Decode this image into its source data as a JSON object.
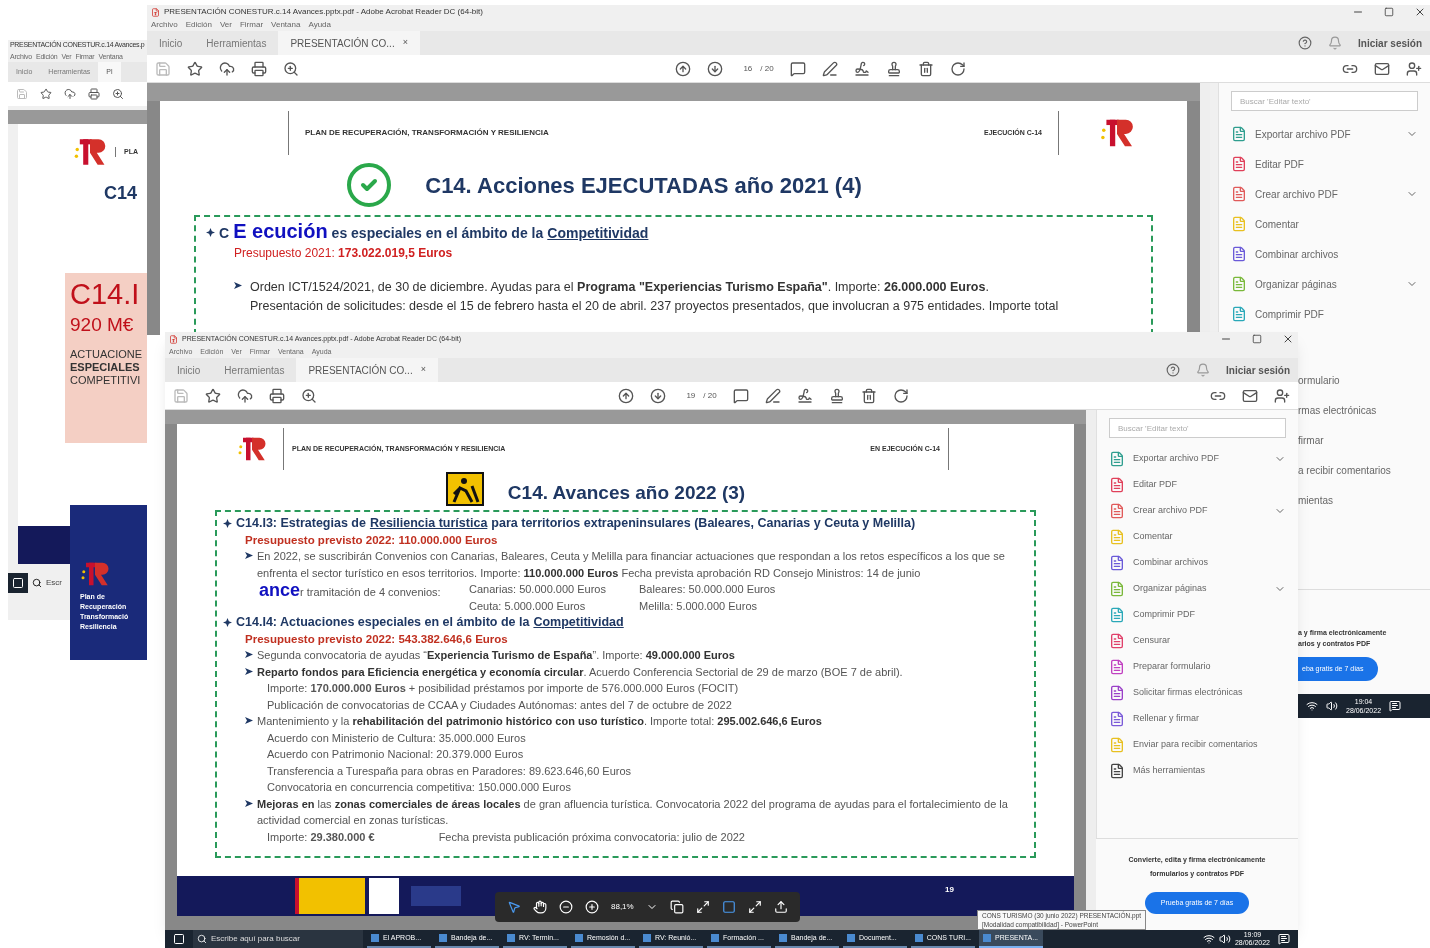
{
  "back_window": {
    "title": "PRESENTACIÓN CONESTUR.c.14 Avances.p",
    "menu": [
      "Archivo",
      "Edición",
      "Ver",
      "Firmar",
      "Ventana"
    ],
    "tabs": [
      {
        "label": "Inicio",
        "selected": false
      },
      {
        "label": "Herramientas",
        "selected": false
      },
      {
        "label": "Pl",
        "selected": true
      }
    ],
    "slide": {
      "header": "PLA",
      "title": "C14",
      "card_code": "C14.I",
      "card_amount": "920 M€",
      "card_lines": [
        "ACTUACIONE",
        "**ESPECIALES**",
        "COMPETITIVI"
      ]
    },
    "taskbar_search": "Escr"
  },
  "blue_card": {
    "lines": [
      "Plan de",
      "Recuperación",
      "Transformació",
      "Resiliencia"
    ]
  },
  "top_window": {
    "title": "PRESENTACIÓN CONESTUR.c.14 Avances.pptx.pdf - Adobe Acrobat Reader DC (64-bit)",
    "menu": [
      "Archivo",
      "Edición",
      "Ver",
      "Firmar",
      "Ventana",
      "Ayuda"
    ],
    "tabs": [
      {
        "label": "Inicio",
        "selected": false
      },
      {
        "label": "Herramientas",
        "selected": false
      },
      {
        "label": "PRESENTACIÓN CO...",
        "selected": true,
        "close": "×"
      }
    ],
    "sign_in": "Iniciar sesión",
    "page": "16",
    "page_total": "/ 20",
    "slide": {
      "header": "PLAN DE RECUPERACIÓN, TRANSFORMACIÓN Y RESILIENCIA",
      "tag": "EJECUCIÓN C-14",
      "title": "C14. Acciones EJECUTADAS año 2021 (4)",
      "heading_start": "C",
      "overlay": "E ecución",
      "heading_rest": "es especiales en el ámbito de la",
      "heading_link": "Competitividad",
      "budget": "Presupuesto 2021: **173.022.019,5 Euros**",
      "bullet": "Orden ICT/1524/2021, de 30 de diciembre. Ayudas para el **Programa \"Experiencias Turismo España\"**.  Importe: **26.000.000 Euros**.",
      "bullet_cont": "Presentación de solicitudes: desde el 15 de febrero hasta el 20 de abril. 237 proyectos presentados, que involucran a 975 entidades. Importe total"
    },
    "search_placeholder": "Buscar 'Editar texto'",
    "tools": [
      {
        "label": "Exportar archivo PDF",
        "color": "#2f9e8f",
        "expandable": true
      },
      {
        "label": "Editar PDF",
        "color": "#e0405a",
        "expandable": false
      },
      {
        "label": "Crear archivo PDF",
        "color": "#e05a5a",
        "expandable": true
      },
      {
        "label": "Comentar",
        "color": "#e8c020",
        "expandable": false
      },
      {
        "label": "Combinar archivos",
        "color": "#6a5ad8",
        "expandable": false
      },
      {
        "label": "Organizar páginas",
        "color": "#7ab83a",
        "expandable": true
      },
      {
        "label": "Comprimir PDF",
        "color": "#2aa8b8",
        "expandable": false
      }
    ],
    "covered_tools": [
      "ormulario",
      "rmas electrónicas",
      "firmar",
      "a recibir comentarios",
      "mientas"
    ],
    "promo": [
      "a y firma electrónicamente",
      "arios y contratos PDF"
    ],
    "trial_button": "eba gratis de 7 días",
    "clock": {
      "time": "19:04",
      "date": "28/06/2022"
    }
  },
  "front_window": {
    "title": "PRESENTACIÓN CONESTUR.c.14 Avances.pptx.pdf - Adobe Acrobat Reader DC (64-bit)",
    "menu": [
      "Archivo",
      "Edición",
      "Ver",
      "Firmar",
      "Ventana",
      "Ayuda"
    ],
    "tabs": [
      {
        "label": "Inicio",
        "selected": false
      },
      {
        "label": "Herramientas",
        "selected": false
      },
      {
        "label": "PRESENTACIÓN CO...",
        "selected": true,
        "close": "×"
      }
    ],
    "sign_in": "Iniciar sesión",
    "page": "19",
    "page_total": "/ 20",
    "slide": {
      "header": "PLAN DE RECUPERACIÓN, TRANSFORMACIÓN Y RESILIENCIA",
      "tag": "EN EJECUCIÓN C-14",
      "title": "C14. Avances año 2022 (3)",
      "sections": [
        {
          "heading": "C14.I3: Estrategias de",
          "heading_link": "Resiliencia turística",
          "heading_rest": "para territorios extrapeninsulares (Baleares, Canarias y Ceuta y Melilla)",
          "budget": "Presupuesto previsto 2022: 110.000.000 Euros",
          "bullets": [
            {
              "text": "En 2022, se suscribirán Convenios con Canarias, Baleares, Ceuta y Melilla para financiar actuaciones que respondan a los retos específicos a los que se enfrenta el sector turístico en esos territorios.  Importe: **110.000.000 Euros**   Fecha prevista aprobación RD Consejo Ministros: 14 de junio"
            }
          ],
          "overlay": "ance",
          "pending": "r tramitación de 4 convenios:",
          "convenios": [
            "Canarias: 50.000.000 Euros",
            "Baleares: 50.000.000 Euros",
            "Ceuta: 5.000.000 Euros",
            "Melilla: 5.000.000 Euros"
          ]
        },
        {
          "heading": "C14.I4: Actuaciones especiales en el ámbito de la",
          "heading_link": "Competitividad",
          "budget": "Presupuesto previsto 2022: 543.382.646,6 Euros",
          "bullets": [
            {
              "text": "Segunda convocatoria de ayudas “**Experiencia Turismo de España**”. Importe: **49.000.000 Euros**"
            },
            {
              "text": "**Reparto fondos para Eficiencia energética y economía circular**. Acuerdo Conferencia Sectorial de 29 de marzo (BOE 7 de abril).",
              "sub": [
                [
                  "Importe: **170.000.000 Euros**  + posibilidad préstamos por importe de 576.000.000 Euros (FOCIT)"
                ],
                [
                  "Publicación de convocatorias de CCAA y Ciudades Autónomas: antes del 7 de octubre de 2022"
                ]
              ]
            },
            {
              "text": "Mantenimiento y la **rehabilitación del patrimonio histórico con uso turístico**. Importe total: **295.002.646,6 Euros**",
              "sub": [
                [
                  "Acuerdo con Ministerio de Cultura: 35.000.000 Euros"
                ],
                [
                  "Acuerdo con Patrimonio Nacional: 20.379.000 Euros"
                ],
                [
                  "Transferencia a Turespaña para obras en Paradores: 89.623.646,60 Euros"
                ],
                [
                  "Convocatoria en concurrencia competitiva: 150.000.000 Euros"
                ]
              ]
            },
            {
              "text": "**Mejoras en** las **zonas comerciales de áreas locales** de gran afluencia turística. Convocatoria 2022 del programa de ayudas para el fortalecimiento de la actividad comercial en zonas turísticas.",
              "sub": [
                [
                  "Importe: **29.380.000 €**",
                  "Fecha prevista publicación próxima convocatoria: julio de 2022"
                ]
              ]
            }
          ]
        }
      ],
      "page_number": "19"
    },
    "zoom": "88,1%",
    "search_placeholder": "Buscar 'Editar texto'",
    "tools": [
      {
        "label": "Exportar archivo PDF",
        "color": "#2f9e8f",
        "expandable": true
      },
      {
        "label": "Editar PDF",
        "color": "#e0405a",
        "expandable": false
      },
      {
        "label": "Crear archivo PDF",
        "color": "#e05a5a",
        "expandable": true
      },
      {
        "label": "Comentar",
        "color": "#e8c020",
        "expandable": false
      },
      {
        "label": "Combinar archivos",
        "color": "#6a5ad8",
        "expandable": false
      },
      {
        "label": "Organizar páginas",
        "color": "#7ab83a",
        "expandable": true
      },
      {
        "label": "Comprimir PDF",
        "color": "#2aa8b8",
        "expandable": false
      },
      {
        "label": "Censurar",
        "color": "#e0406a",
        "expandable": false
      },
      {
        "label": "Preparar formulario",
        "color": "#c040c0",
        "expandable": false
      },
      {
        "label": "Solicitar firmas electrónicas",
        "color": "#9a40c8",
        "expandable": false
      },
      {
        "label": "Rellenar y firmar",
        "color": "#7a5ad8",
        "expandable": false
      },
      {
        "label": "Enviar para recibir comentarios",
        "color": "#e8c020",
        "expandable": false
      },
      {
        "label": "Más herramientas",
        "color": "#444444",
        "expandable": false
      }
    ],
    "promo": [
      "Convierte, edita y firma electrónicamente",
      "formularios y contratos PDF"
    ],
    "trial_button": "Prueba gratis de 7 días",
    "tooltip": [
      "CONS TURISMO (30 junio 2022) PRESENTACIÓN.ppt",
      "[Modalidad compatibilidad] - PowerPoint"
    ]
  },
  "taskbar": {
    "search_placeholder": "Escribe aquí para buscar",
    "apps": [
      {
        "label": "El APROB...",
        "selected": false
      },
      {
        "label": "Bandeja de...",
        "selected": false
      },
      {
        "label": "RV: Termin...",
        "selected": false
      },
      {
        "label": "Remosión d...",
        "selected": false
      },
      {
        "label": "RV: Reunió...",
        "selected": false
      },
      {
        "label": "Formación ...",
        "selected": false
      },
      {
        "label": "Bandeja de...",
        "selected": false
      },
      {
        "label": "Document...",
        "selected": false
      },
      {
        "label": "CONS TURI...",
        "selected": false
      },
      {
        "label": "PRESENTA...",
        "selected": true
      }
    ],
    "time": "19:09",
    "date": "28/06/2022"
  }
}
